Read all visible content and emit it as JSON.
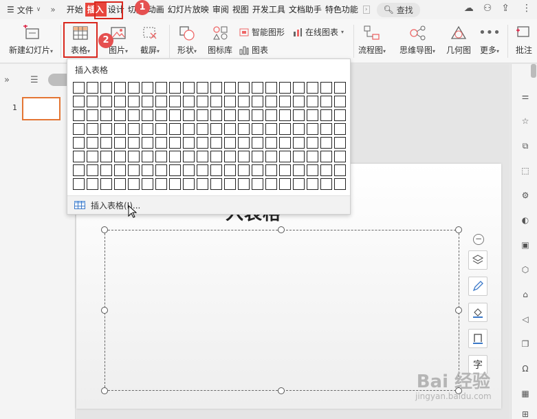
{
  "menubar": {
    "file_label": "文件",
    "tabs": [
      "开始",
      "插入",
      "设计",
      "切换",
      "动画",
      "幻灯片放映",
      "审阅",
      "视图",
      "开发工具",
      "文档助手",
      "特色功能"
    ],
    "active_tab": "插入",
    "search_label": "查找"
  },
  "ribbon": {
    "new_slide": "新建幻灯片",
    "table": "表格",
    "picture": "图片",
    "screenshot": "截屏",
    "shape": "形状",
    "icon_lib": "图标库",
    "smart_art": "智能图形",
    "online_chart": "在线图表",
    "chart": "图表",
    "flowchart": "流程图",
    "mindmap": "思维导图",
    "geometry": "几何图",
    "more": "更多",
    "comment": "批注"
  },
  "annotations": {
    "step1": "1",
    "step2": "2"
  },
  "leftpanel": {
    "slide_number": "1"
  },
  "slide": {
    "title": "入表格"
  },
  "dropdown": {
    "title": "插入表格",
    "grid_cols": 20,
    "grid_rows": 8,
    "footer_label": "插入表格(I)..."
  },
  "watermark": {
    "brand": "Bai 经验",
    "url": "jingyan.baidu.com"
  },
  "colors": {
    "accent": "#e8453c",
    "selection": "#e47533",
    "annotation": "#d9261c"
  }
}
